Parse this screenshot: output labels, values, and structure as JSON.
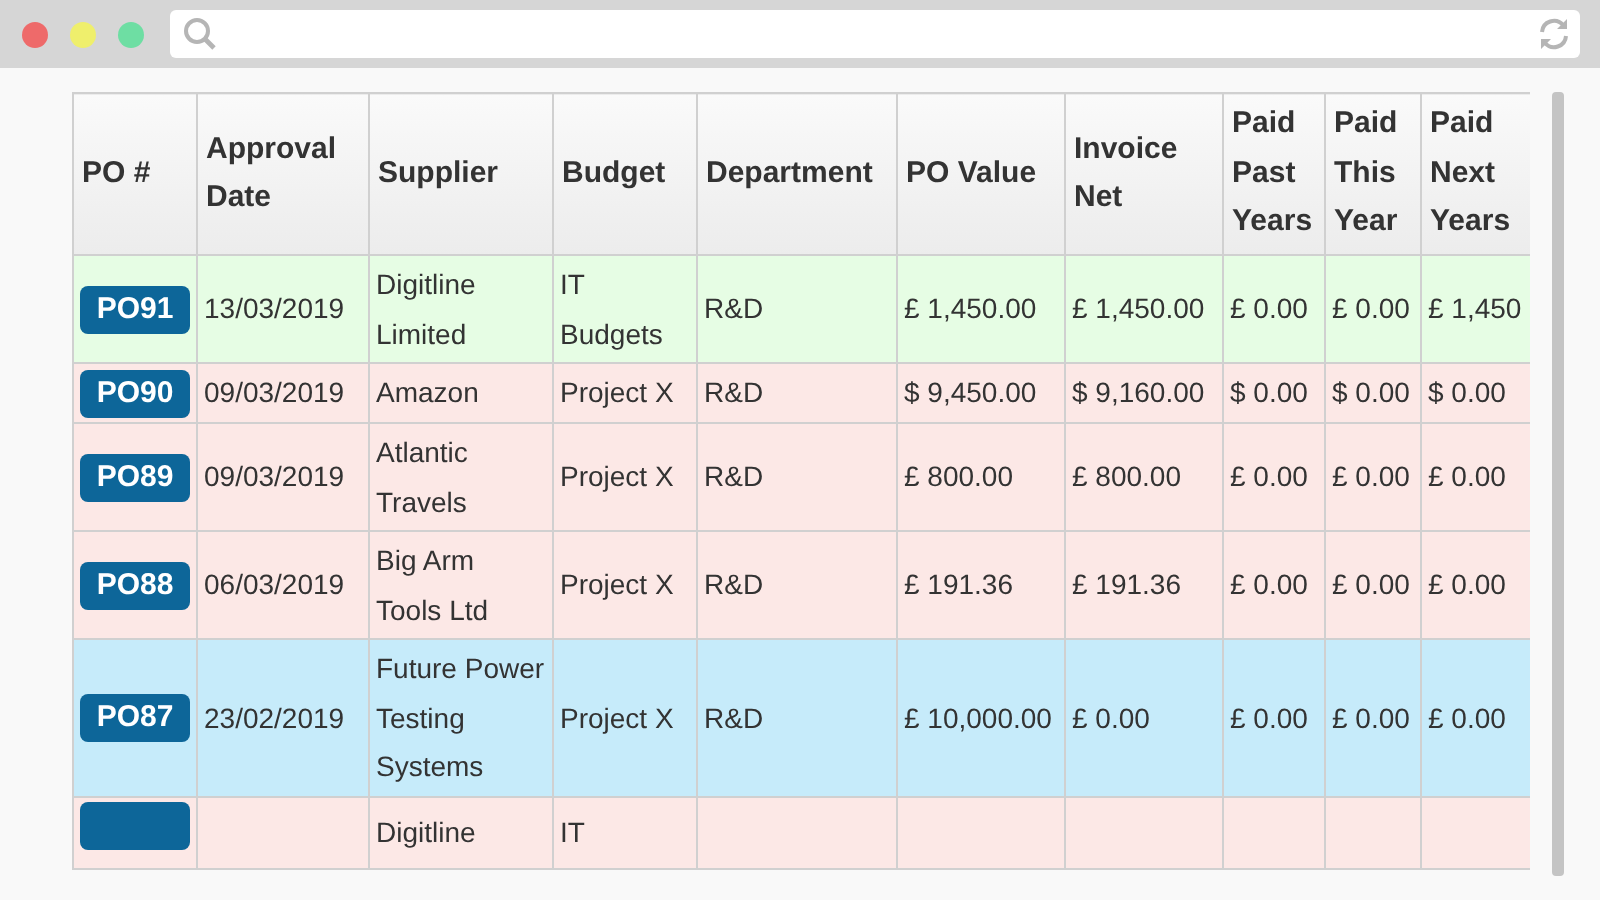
{
  "table": {
    "columns": [
      "PO #",
      "Approval Date",
      "Supplier",
      "Budget",
      "Department",
      "PO Value",
      "Invoice Net",
      "Paid Past Years",
      "Paid This Year",
      "Paid Next Years"
    ],
    "rows": [
      {
        "color": "#e6fde4",
        "cells": [
          "PO91",
          "13/03/2019",
          "Digitline Limited",
          "IT Budgets",
          "R&D",
          "£ 1,450.00",
          "£ 1,450.00",
          "£ 0.00",
          "£ 0.00",
          "£ 1,450"
        ]
      },
      {
        "color": "#fce8e6",
        "cells": [
          "PO90",
          "09/03/2019",
          "Amazon",
          "Project X",
          "R&D",
          "$ 9,450.00",
          "$ 9,160.00",
          "$ 0.00",
          "$ 0.00",
          "$ 0.00"
        ]
      },
      {
        "color": "#fce8e6",
        "cells": [
          "PO89",
          "09/03/2019",
          "Atlantic Travels",
          "Project X",
          "R&D",
          "£ 800.00",
          "£ 800.00",
          "£ 0.00",
          "£ 0.00",
          "£ 0.00"
        ]
      },
      {
        "color": "#fce8e6",
        "cells": [
          "PO88",
          "06/03/2019",
          "Big Arm Tools Ltd",
          "Project X",
          "R&D",
          "£ 191.36",
          "£ 191.36",
          "£ 0.00",
          "£ 0.00",
          "£ 0.00"
        ]
      },
      {
        "color": "#c6ebfa",
        "cells": [
          "PO87",
          "23/02/2019",
          "Future Power Testing Systems",
          "Project X",
          "R&D",
          "£ 10,000.00",
          "£ 0.00",
          "£ 0.00",
          "£ 0.00",
          "£ 0.00"
        ]
      },
      {
        "color": "#fce8e6",
        "cells": [
          null,
          null,
          "Digitline",
          "IT",
          null,
          null,
          null,
          null,
          null,
          null
        ]
      }
    ]
  }
}
